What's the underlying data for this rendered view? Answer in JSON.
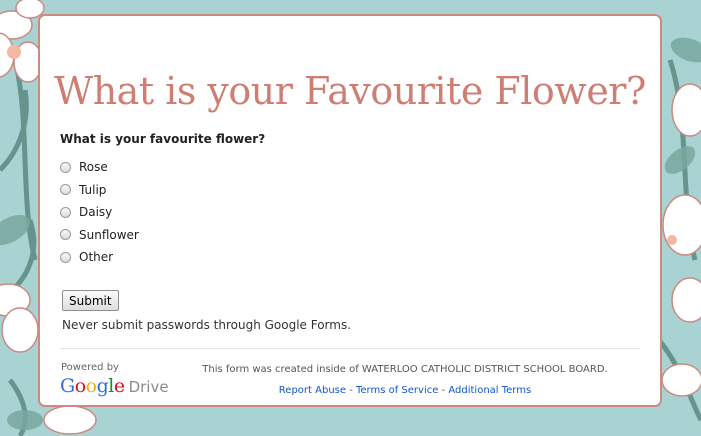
{
  "page": {
    "title": "What is your Favourite Flower?"
  },
  "form": {
    "question": "What is your favourite flower?",
    "options": [
      "Rose",
      "Tulip",
      "Daisy",
      "Sunflower",
      "Other"
    ],
    "submit_label": "Submit",
    "password_warning": "Never submit passwords through Google Forms."
  },
  "footer": {
    "powered_by": "Powered by",
    "brand_google": "Google",
    "brand_drive": "Drive",
    "created_note": "This form was created inside of WATERLOO CATHOLIC DISTRICT SCHOOL BOARD.",
    "links": {
      "report_abuse": "Report Abuse",
      "separator_1": " - ",
      "terms": "Terms of Service",
      "separator_2": " - ",
      "additional": "Additional Terms"
    }
  },
  "theme": {
    "background": "#a9d2d3",
    "accent": "#cf7e74",
    "link": "#1155cc",
    "google_letter_colors": [
      "#3369e8",
      "#d50f25",
      "#eeb211",
      "#3369e8",
      "#009925",
      "#d50f25"
    ]
  }
}
